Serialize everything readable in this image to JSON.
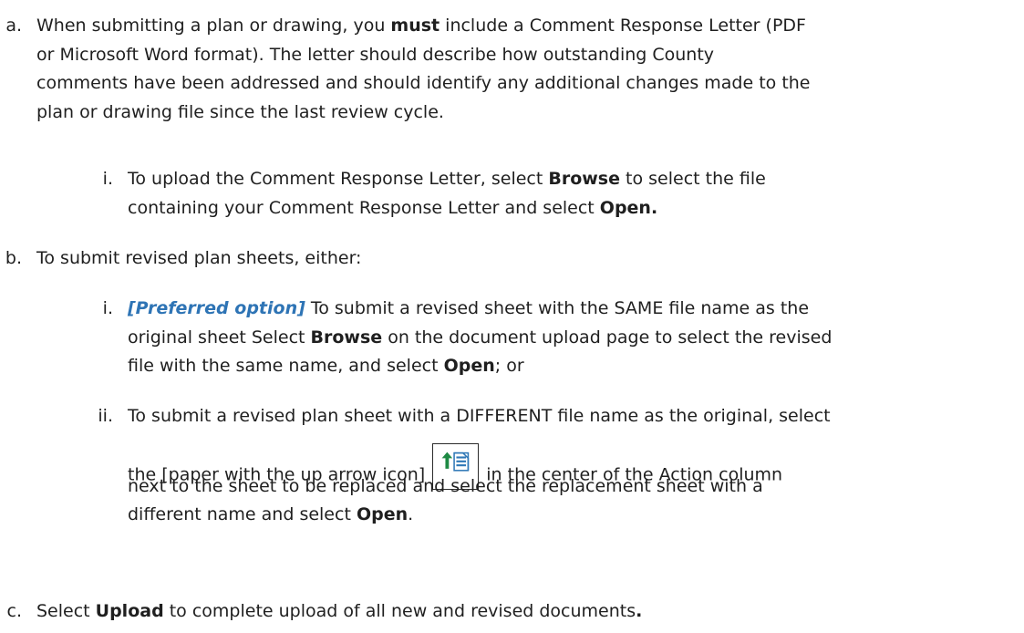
{
  "doc": {
    "a": {
      "marker": "a.",
      "l1_pre": "When submitting a plan or drawing, you ",
      "l1_bold": "must",
      "l1_post": " include a Comment Response Letter (PDF",
      "l2": "or Microsoft Word format).  The letter should describe how outstanding County",
      "l3": "comments have been addressed and should identify any additional changes made to the",
      "l4": "plan or drawing file since the last review cycle.",
      "i": {
        "marker": "i.",
        "l1_pre": "To upload the Comment Response Letter, select ",
        "l1_bold": "Browse",
        "l1_post": " to select the file",
        "l2_pre": "containing your Comment Response Letter and select ",
        "l2_bold": "Open."
      }
    },
    "b": {
      "marker": "b.",
      "text": "To submit revised plan sheets, either:",
      "i": {
        "marker": "i.",
        "l1_pref": "[Preferred option]",
        "l1_post": " To submit a revised sheet with the SAME file name as the",
        "l2_pre": "original sheet Select ",
        "l2_bold": "Browse",
        "l2_post": " on the document upload page to select the revised",
        "l3_pre": "file with the same name, and select ",
        "l3_bold": "Open",
        "l3_post": "; or"
      },
      "ii": {
        "marker": "ii.",
        "l1": "To submit a revised plan sheet with a DIFFERENT file name as the original, select",
        "l2_pre": "the [paper with the up arrow icon] ",
        "l2_post": " in the center of the Action column",
        "l3": "next to the sheet to be replaced and select the replacement sheet with a",
        "l4_pre": "different name and select ",
        "l4_bold": "Open",
        "l4_post": "."
      }
    },
    "c": {
      "marker": "c.",
      "pre": "Select ",
      "bold1": "Upload",
      "post": " to complete upload of all new and revised documents",
      "bold2": "."
    }
  },
  "icons": {
    "upload_replacement": "paper-with-up-arrow-icon"
  },
  "colors": {
    "text": "#1f1f1f",
    "preferred_option": "#2e74b5",
    "icon_arrow": "#1e8a44",
    "icon_paper": "#2f78b7"
  }
}
